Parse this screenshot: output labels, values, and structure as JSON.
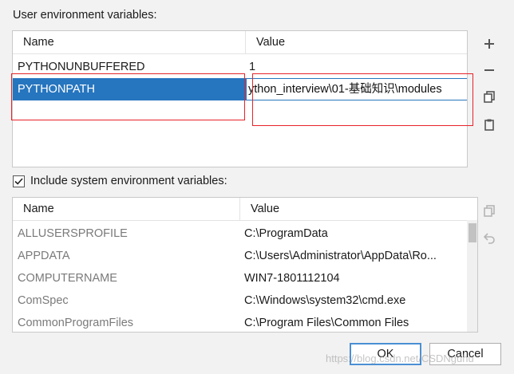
{
  "user_section": {
    "label": "User environment variables:",
    "headers": {
      "name": "Name",
      "value": "Value"
    },
    "rows": [
      {
        "name": "PYTHONUNBUFFERED",
        "value": "1"
      },
      {
        "name": "PYTHONPATH",
        "value": "ython_interview\\01-基础知识\\modules"
      }
    ],
    "actions": {
      "add": "add-icon",
      "remove": "remove-icon",
      "copy": "copy-icon",
      "paste": "paste-icon"
    }
  },
  "system_section": {
    "checkbox_label": "Include system environment variables:",
    "checked": true,
    "headers": {
      "name": "Name",
      "value": "Value"
    },
    "rows": [
      {
        "name": "ALLUSERSPROFILE",
        "value": "C:\\ProgramData"
      },
      {
        "name": "APPDATA",
        "value": "C:\\Users\\Administrator\\AppData\\Ro..."
      },
      {
        "name": "COMPUTERNAME",
        "value": "WIN7-1801112104"
      },
      {
        "name": "ComSpec",
        "value": "C:\\Windows\\system32\\cmd.exe"
      },
      {
        "name": "CommonProgramFiles",
        "value": "C:\\Program Files\\Common Files"
      }
    ],
    "actions": {
      "copy": "copy-icon",
      "revert": "revert-icon"
    }
  },
  "footer": {
    "ok_label": "OK",
    "cancel_label": "Cancel",
    "watermark": "https://blog.csdn.net/CSDNguhu"
  },
  "colors": {
    "selection": "#2675bf",
    "highlight_box": "#e8232a",
    "default_button_border": "#4a8fd4"
  }
}
